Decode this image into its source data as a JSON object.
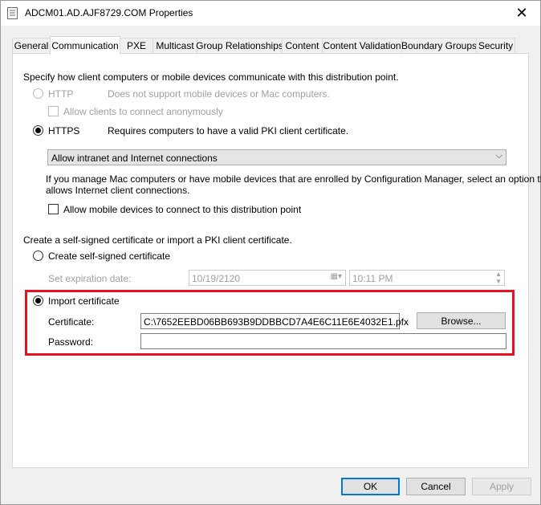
{
  "window": {
    "title": "ADCM01.AD.AJF8729.COM Properties",
    "close_glyph": "✕"
  },
  "tabs": [
    {
      "label": "General"
    },
    {
      "label": "Communication"
    },
    {
      "label": "PXE"
    },
    {
      "label": "Multicast"
    },
    {
      "label": "Group Relationships"
    },
    {
      "label": "Content"
    },
    {
      "label": "Content Validation"
    },
    {
      "label": "Boundary Groups"
    },
    {
      "label": "Security"
    }
  ],
  "communication": {
    "intro": "Specify how client computers or mobile devices communicate with this distribution point.",
    "http_label": "HTTP",
    "http_desc": "Does not support mobile devices or Mac computers.",
    "anon_label": "Allow clients to connect anonymously",
    "https_label": "HTTPS",
    "https_desc": "Requires computers to have a valid PKI client certificate.",
    "connection_selected": "Allow intranet and Internet connections",
    "mac_info_line1": "If you manage Mac computers or have mobile devices that are enrolled by Configuration Manager, select an option that",
    "mac_info_line2": "allows Internet client connections.",
    "mobile_label": "Allow mobile devices to connect to this distribution point",
    "cert_intro": "Create a self-signed certificate or import a PKI client certificate.",
    "self_signed_label": "Create self-signed certificate",
    "expiration_label": "Set expiration date:",
    "expiration_date": "10/19/2120",
    "expiration_time": "10:11 PM",
    "import_label": "Import certificate",
    "certificate_label": "Certificate:",
    "certificate_value": "C:\\7652EEBD06BB693B9DDBBCD7A4E6C11E6E4032E1.pfx",
    "browse_label": "Browse...",
    "password_label": "Password:",
    "password_value": ""
  },
  "footer": {
    "ok_label": "OK",
    "cancel_label": "Cancel",
    "apply_label": "Apply"
  },
  "colors": {
    "highlight": "#e81123",
    "default_button_border": "#0078d7"
  }
}
